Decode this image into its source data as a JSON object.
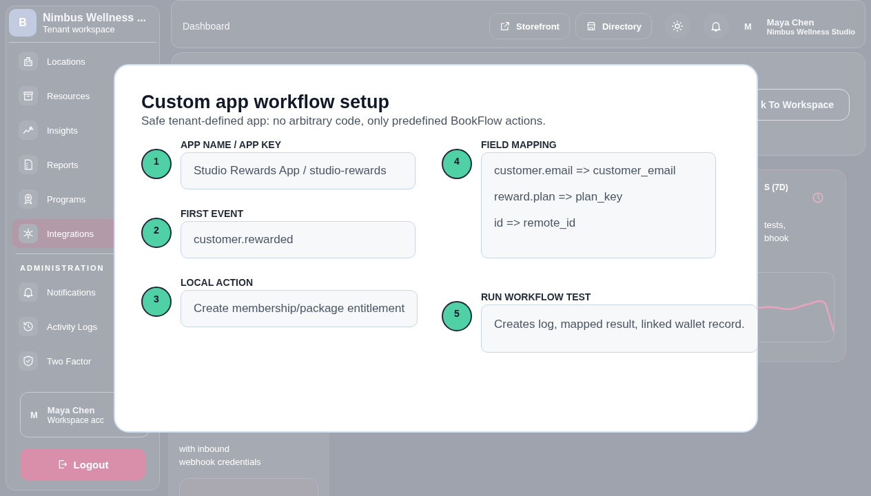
{
  "sidebar": {
    "brand": {
      "initial": "B",
      "name": "Nimbus Wellness ...",
      "subtitle": "Tenant workspace"
    },
    "items": [
      {
        "label": "Locations",
        "selected": false
      },
      {
        "label": "Resources",
        "selected": false
      },
      {
        "label": "Insights",
        "selected": false
      },
      {
        "label": "Reports",
        "selected": false
      },
      {
        "label": "Programs",
        "selected": false
      },
      {
        "label": "Integrations",
        "selected": true
      }
    ],
    "section": "ADMINISTRATION",
    "admin_items": [
      {
        "label": "Notifications",
        "selected": false
      },
      {
        "label": "Activity Logs",
        "selected": false
      },
      {
        "label": "Two Factor",
        "selected": false
      }
    ],
    "user": {
      "initial": "M",
      "name": "Maya Chen",
      "subtitle": "Workspace acc"
    },
    "logout": "Logout"
  },
  "header": {
    "breadcrumb": "Dashboard",
    "links": [
      "Storefront",
      "Directory"
    ],
    "user": {
      "initial": "M",
      "name": "Maya Chen",
      "org": "Nimbus Wellness Studio"
    }
  },
  "back_button": "k To Workspace",
  "activity_card": {
    "title": "S (7D)",
    "lines": [
      "tests,",
      "bhook"
    ]
  },
  "connectors_card": {
    "lines": [
      "with inbound",
      "webhook credentials"
    ]
  },
  "modal": {
    "title": "Custom app workflow setup",
    "subtitle": "Safe tenant-defined app: no arbitrary code, only predefined BookFlow actions.",
    "columns": [
      [
        {
          "number": "1",
          "label": "APP NAME / APP KEY",
          "kind": "input",
          "lines": [
            "Studio Rewards App / studio-rewards"
          ]
        },
        {
          "number": "2",
          "label": "FIRST EVENT",
          "kind": "input",
          "lines": [
            "customer.rewarded"
          ]
        },
        {
          "number": "3",
          "label": "LOCAL ACTION",
          "kind": "input",
          "lines": [
            "Create membership/package entitlement"
          ]
        }
      ],
      [
        {
          "number": "4",
          "label": "FIELD MAPPING",
          "kind": "mapping",
          "lines": [
            "customer.email => customer_email",
            "reward.plan => plan_key",
            "id => remote_id"
          ]
        },
        {
          "number": "5",
          "label": "RUN WORKFLOW TEST",
          "kind": "result",
          "lines": [
            "Creates log, mapped result, linked wallet record."
          ]
        }
      ]
    ]
  }
}
